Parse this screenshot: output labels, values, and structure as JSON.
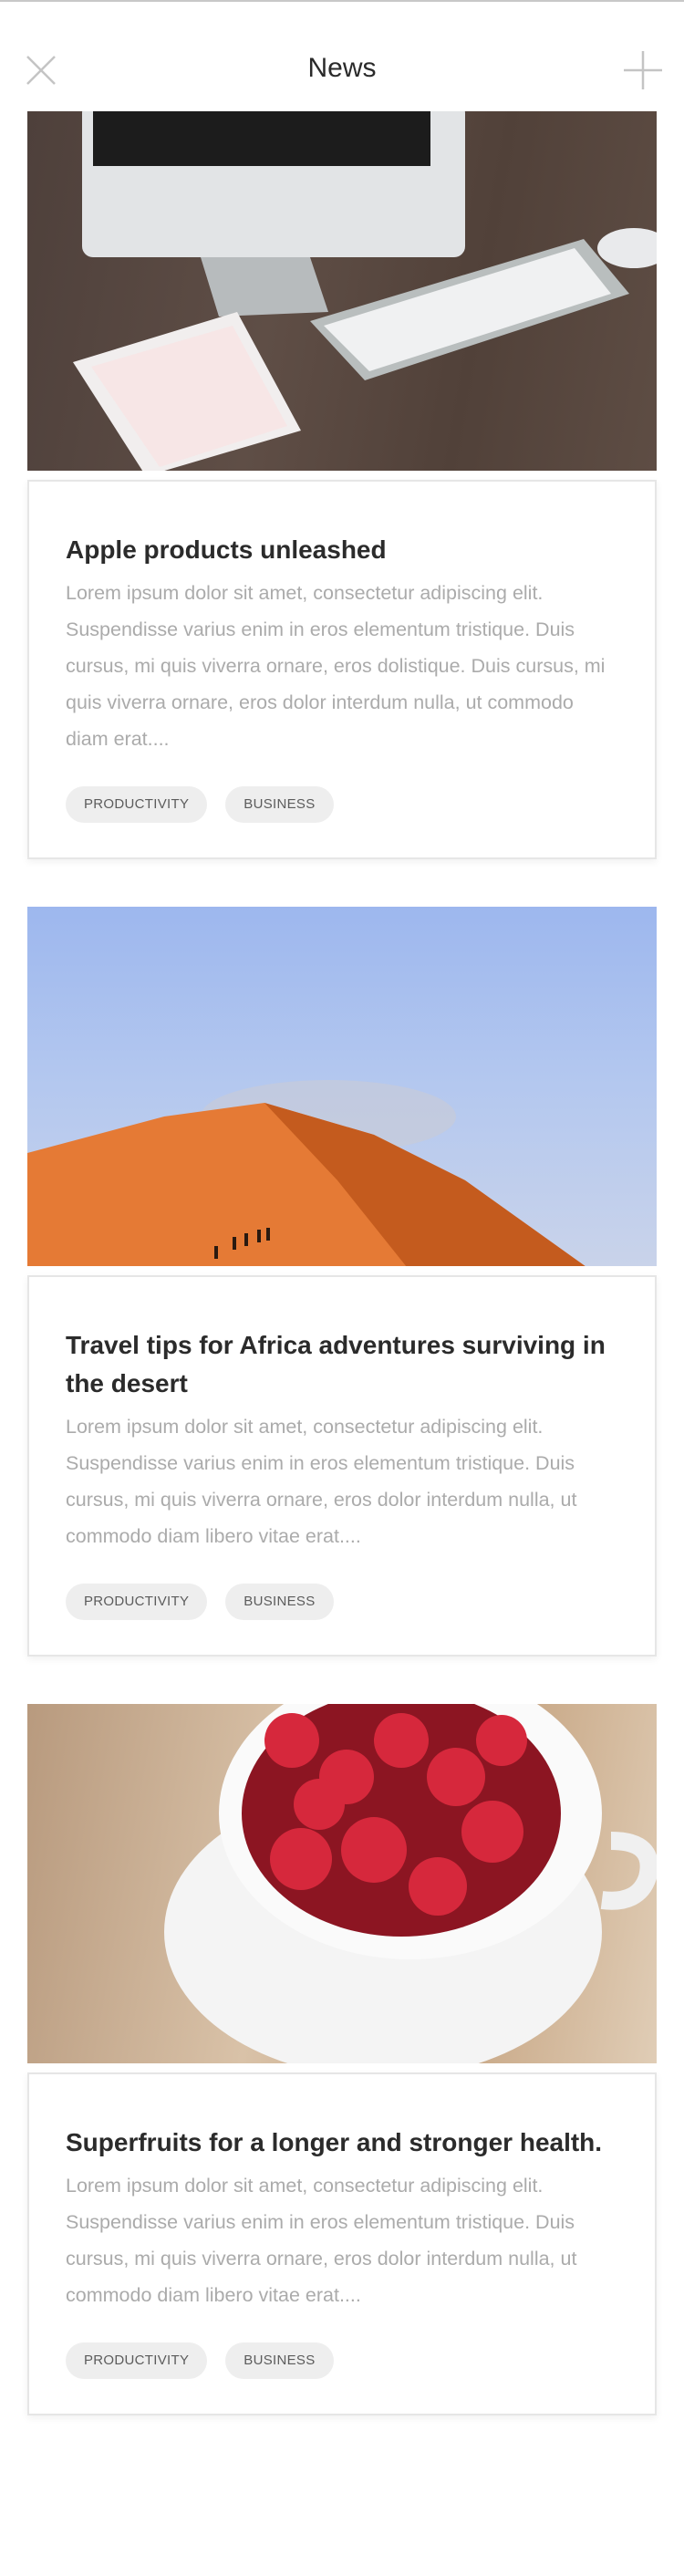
{
  "header": {
    "title": "News",
    "close_icon": "close-icon",
    "add_icon": "plus-icon"
  },
  "articles": [
    {
      "image": "desk with computer, keyboard and tablet",
      "title": "Apple products unleashed",
      "text": "Lorem ipsum dolor sit amet, consectetur adipiscing elit. Suspendisse varius enim in eros elementum tristique. Duis cursus, mi quis viverra ornare, eros dolistique. Duis cursus, mi quis viverra ornare, eros dolor interdum nulla, ut commodo diam erat....",
      "tags": [
        "PRODUCTIVITY",
        "BUSINESS"
      ]
    },
    {
      "image": "desert dune with travelers",
      "title": "Travel tips for Africa adventures surviving in the desert",
      "text": "Lorem ipsum dolor sit amet, consectetur adipiscing elit. Suspendisse varius enim in eros elementum tristique. Duis cursus, mi quis viverra ornare, eros dolor interdum nulla, ut commodo diam libero vitae erat....",
      "tags": [
        "PRODUCTIVITY",
        "BUSINESS"
      ]
    },
    {
      "image": "cup of raspberries",
      "title": "Superfruits for a longer and stronger health.",
      "text": "Lorem ipsum dolor sit amet, consectetur adipiscing elit. Suspendisse varius enim in eros elementum tristique. Duis cursus, mi quis viverra ornare, eros dolor interdum nulla, ut commodo diam libero vitae erat....",
      "tags": [
        "PRODUCTIVITY",
        "BUSINESS"
      ]
    }
  ],
  "colors": {
    "title": "#2b2b2b",
    "text": "#ababab",
    "tag_bg": "#eeeeee",
    "tag_text": "#5c5c5c"
  }
}
